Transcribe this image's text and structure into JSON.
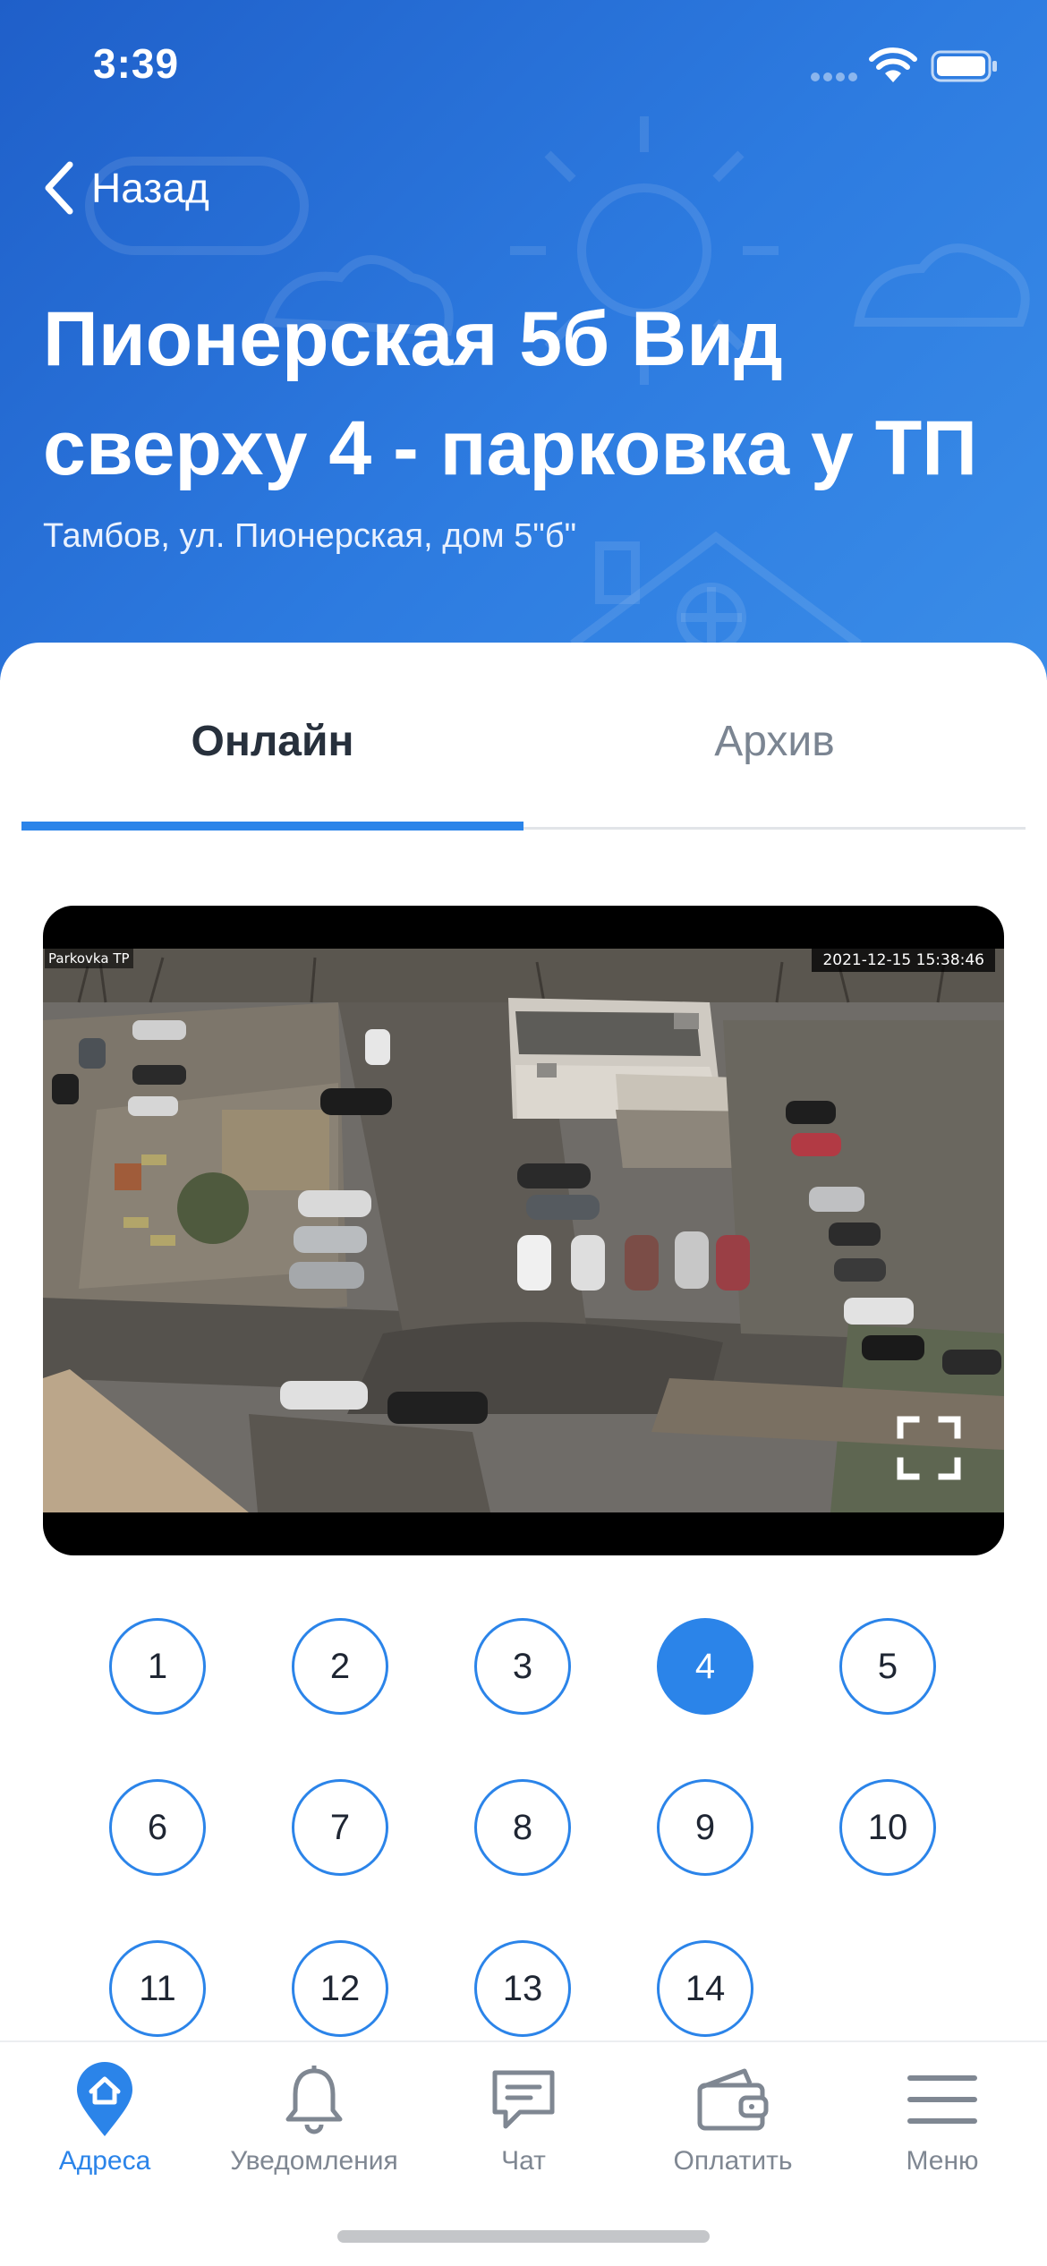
{
  "status_bar": {
    "time": "3:39"
  },
  "header": {
    "back_label": "Назад",
    "title": "Пионерская 5б Вид сверху 4 - парковка у ТП",
    "subtitle": "Тамбов, ул. Пионерская, дом 5\"б\""
  },
  "tabs": [
    {
      "label": "Онлайн",
      "active": true
    },
    {
      "label": "Архив",
      "active": false
    }
  ],
  "video": {
    "camera_label": "Parkovka TP",
    "timestamp": "2021-12-15 15:38:46",
    "fullscreen_icon": "fullscreen-icon"
  },
  "cameras": {
    "selected": "4",
    "numbers": [
      "1",
      "2",
      "3",
      "4",
      "5",
      "6",
      "7",
      "8",
      "9",
      "10",
      "11",
      "12",
      "13",
      "14"
    ]
  },
  "tabbar": {
    "items": [
      {
        "label": "Адреса",
        "icon": "home-pin-icon",
        "active": true
      },
      {
        "label": "Уведомления",
        "icon": "bell-icon",
        "active": false
      },
      {
        "label": "Чат",
        "icon": "chat-icon",
        "active": false
      },
      {
        "label": "Оплатить",
        "icon": "wallet-icon",
        "active": false
      },
      {
        "label": "Меню",
        "icon": "menu-icon",
        "active": false
      }
    ]
  },
  "colors": {
    "accent": "#2b84e9",
    "header_start": "#1f5fc9",
    "header_end": "#3a8de8",
    "inactive_text": "#7f8792"
  }
}
